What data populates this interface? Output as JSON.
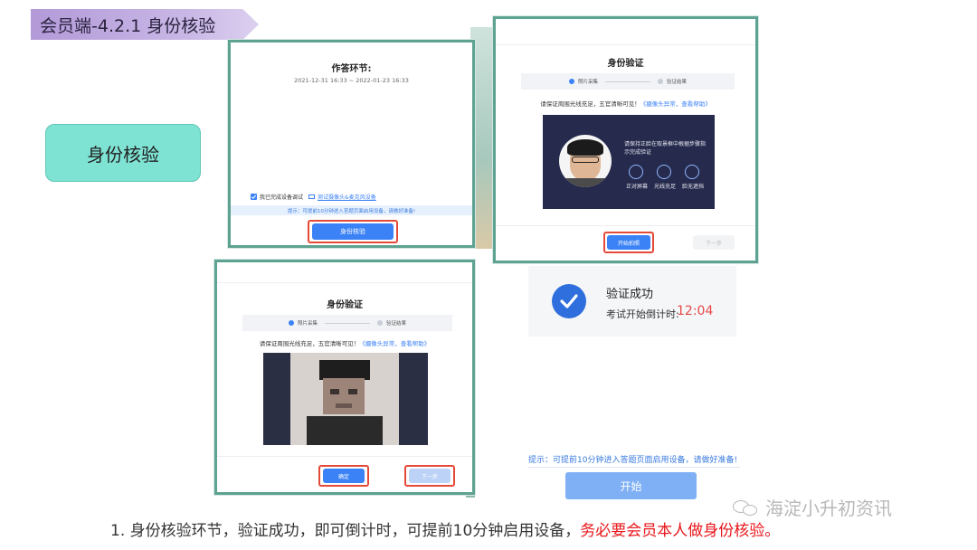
{
  "header": {
    "title": "会员端-4.2.1  身份核验"
  },
  "badge": {
    "label": "身份核验"
  },
  "panel1": {
    "title": "作答环节:",
    "time_range": "2021-12-31 16:33 ~ 2022-01-23 16:33",
    "checkbox_label": "我已完成设备调试",
    "test_link": "测试摄像头&麦克风设备",
    "hint": "提示：可提前10分钟进入答题页面启用设备，请做好准备!",
    "button": "身份核验"
  },
  "panel2": {
    "title": "身份验证",
    "step1": "照片采集",
    "step2": "验证结果",
    "instruction": "请保证周围光线充足，五官清晰可见！",
    "help_link": "《摄像头异常，查看帮助》",
    "guide_text": "请保持正脸在取景框中根据步骤指示完成验证",
    "guide_items": [
      "正对屏幕",
      "光线充足",
      "脸无遮挡"
    ],
    "primary_button": "开始拍照",
    "secondary_button": "下一步"
  },
  "panel3": {
    "title": "身份验证",
    "step1": "照片采集",
    "step2": "验证结果",
    "instruction": "请保证周围光线充足，五官清晰可见！",
    "help_link": "《摄像头异常，查看帮助》",
    "primary_button": "确定",
    "secondary_button": "下一步"
  },
  "success": {
    "title": "验证成功",
    "countdown_label": "考试开始倒计时:",
    "countdown_value": "12:04"
  },
  "bottom_tip": "提示：可提前10分钟进入答题页面启用设备，请做好准备!",
  "start_button": "开始",
  "watermark": "海淀小升初资讯",
  "caption": {
    "normal": "1. 身份核验环节，验证成功，即可倒计时，可提前10分钟启用设备，",
    "warning": "务必要会员本人做身份核验。"
  }
}
